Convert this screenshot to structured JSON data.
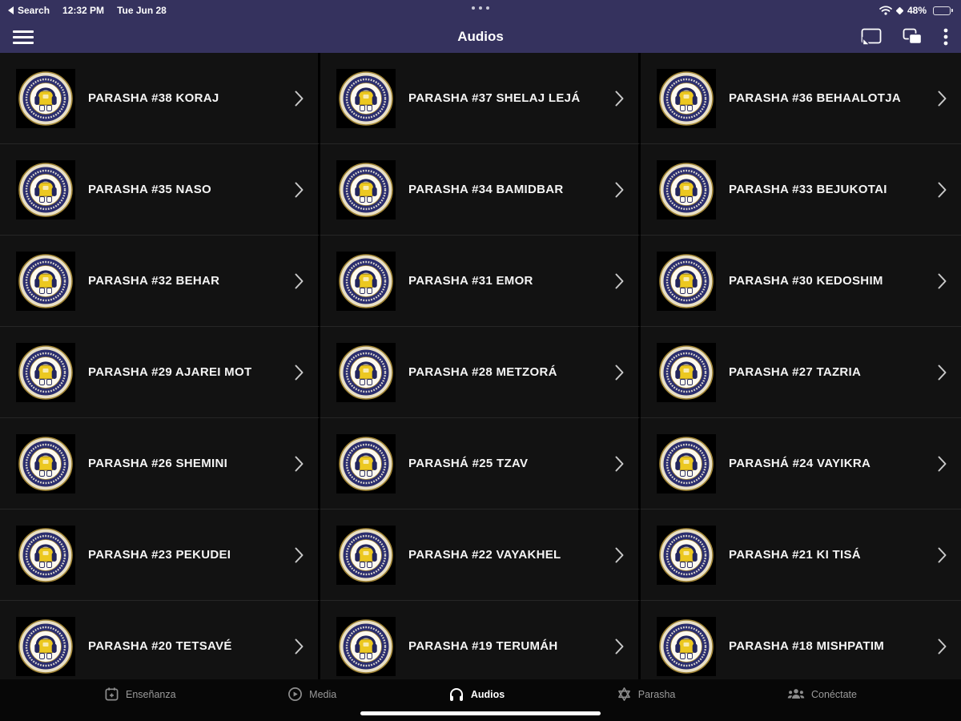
{
  "status_bar": {
    "back_label": "Search",
    "time": "12:32 PM",
    "date": "Tue Jun 28",
    "battery_percent": "48%"
  },
  "nav": {
    "title": "Audios"
  },
  "audio_items": [
    {
      "title": "PARASHA #38 KORAJ"
    },
    {
      "title": "PARASHA #37 SHELAJ LEJÁ"
    },
    {
      "title": "PARASHA #36 BEHAALOTJA"
    },
    {
      "title": "PARASHA #35 NASO"
    },
    {
      "title": "PARASHA #34 BAMIDBAR"
    },
    {
      "title": "PARASHA #33 BEJUKOTAI"
    },
    {
      "title": "PARASHA #32 BEHAR"
    },
    {
      "title": "PARASHA #31 EMOR"
    },
    {
      "title": "PARASHA #30 KEDOSHIM"
    },
    {
      "title": "PARASHA #29 AJAREI MOT"
    },
    {
      "title": "PARASHA #28 METZORÁ"
    },
    {
      "title": "PARASHA #27 TAZRIA"
    },
    {
      "title": "PARASHA #26 SHEMINI"
    },
    {
      "title": "PARASHÁ #25 TZAV"
    },
    {
      "title": "PARASHÁ #24 VAYIKRA"
    },
    {
      "title": "PARASHA #23 PEKUDEI"
    },
    {
      "title": "PARASHA #22 VAYAKHEL"
    },
    {
      "title": "PARASHA #21 KI TISÁ"
    },
    {
      "title": "PARASHA #20 TETSAVÉ"
    },
    {
      "title": "PARASHA #19 TERUMÁH"
    },
    {
      "title": "PARASHA #18 MISHPATIM"
    }
  ],
  "tabs": [
    {
      "label": "Enseñanza",
      "icon": "calendar-icon",
      "active": false
    },
    {
      "label": "Media",
      "icon": "play-circle-icon",
      "active": false
    },
    {
      "label": "Audios",
      "icon": "headphones-icon",
      "active": true
    },
    {
      "label": "Parasha",
      "icon": "star-of-david-icon",
      "active": false
    },
    {
      "label": "Conéctate",
      "icon": "people-group-icon",
      "active": false
    }
  ],
  "colors": {
    "nav_bar": "#35325e",
    "content_bg": "#000000",
    "cell_bg": "#121212",
    "accent_yellow": "#ecc820",
    "logo_navy": "#2b2e6e",
    "tab_bar_bg": "#070707",
    "active_tab": "#ffffff",
    "inactive_tab": "#9a9a9a"
  }
}
